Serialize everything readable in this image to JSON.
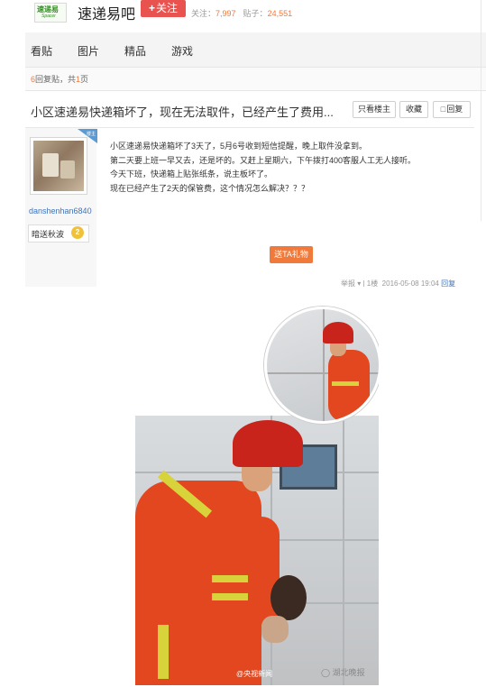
{
  "header": {
    "logo_text": "速递易",
    "logo_subtext": "Spacer",
    "forum_name": "速递易吧",
    "follow_label": "关注",
    "stats": {
      "follow_label": "关注：",
      "follow_count": "7,997",
      "posts_label": "贴子：",
      "posts_count": "24,551"
    }
  },
  "nav": {
    "tabs": [
      "看贴",
      "图片",
      "精品",
      "游戏"
    ]
  },
  "page_info": {
    "reply_count": "6",
    "reply_suffix": "回复贴，共",
    "page_count": "1",
    "page_suffix": "页"
  },
  "post": {
    "title": "小区速递易快递箱坏了，现在无法取件，已经产生了费用...",
    "buttons": {
      "only_author": "只看楼主",
      "collect": "收藏",
      "reply": "回复"
    },
    "author": {
      "tag": "楼主",
      "username": "danshenhan6840",
      "badge_label": "暗送秋波",
      "level": "2"
    },
    "body_lines": [
      "小区速递易快递箱坏了3天了，5月6号收到短信提醒，晚上取件没拿到。",
      "第二天要上班一早又去，还是坏的。又赶上星期六，下午拨打400客服人工无人接听。",
      "今天下班，快递箱上贴张纸条，说主板坏了。",
      "现在已经产生了2天的保管费，这个情况怎么解决？？？"
    ],
    "gift_label": "送TA礼物",
    "footer": {
      "report": "举报",
      "floor": "1楼",
      "time": "2016-05-08 19:04",
      "reply": "回复"
    }
  },
  "photo": {
    "watermark_left": "@央视新闻",
    "watermark_right": "湖北晚报"
  },
  "colors": {
    "accent_red": "#e85350",
    "accent_orange": "#f07a3c",
    "link_blue": "#3e73b8",
    "count_orange": "#f2783e"
  }
}
